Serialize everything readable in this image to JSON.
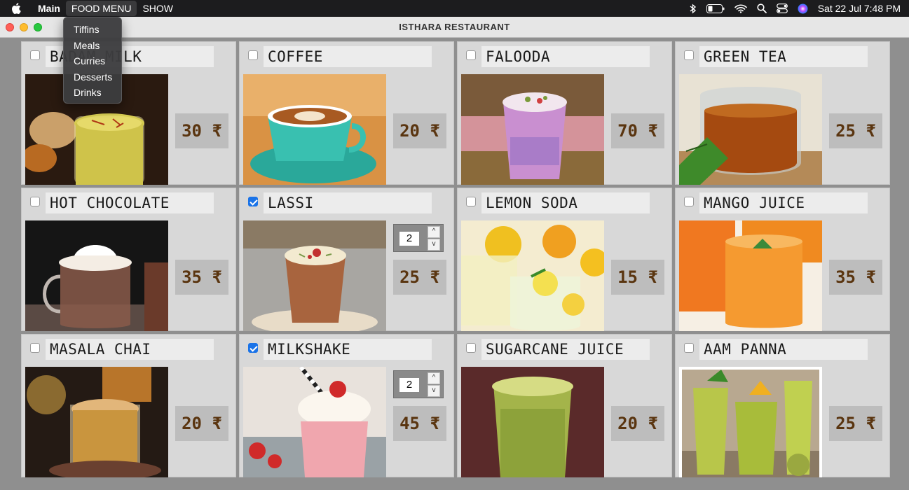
{
  "menubar": {
    "app_name": "Main",
    "menus": [
      "FOOD MENU",
      "SHOW"
    ],
    "active_menu": "FOOD MENU",
    "clock": "Sat 22 Jul  7:48 PM"
  },
  "window": {
    "title": "ISTHARA RESTAURANT"
  },
  "food_menu_dropdown": [
    "Tiffins",
    "Meals",
    "Curries",
    "Desserts",
    "Drinks"
  ],
  "items": [
    {
      "name": "BADAM MILK",
      "price": "30 ₹",
      "checked": false,
      "photo": "badam-milk"
    },
    {
      "name": "COFFEE",
      "price": "20 ₹",
      "checked": false,
      "photo": "coffee"
    },
    {
      "name": "FALOODA",
      "price": "70 ₹",
      "checked": false,
      "photo": "falooda"
    },
    {
      "name": "GREEN TEA",
      "price": "25 ₹",
      "checked": false,
      "photo": "green-tea"
    },
    {
      "name": "HOT CHOCOLATE",
      "price": "35 ₹",
      "checked": false,
      "photo": "hot-chocolate"
    },
    {
      "name": "LASSI",
      "price": "25 ₹",
      "checked": true,
      "quantity": "2",
      "photo": "lassi"
    },
    {
      "name": "LEMON SODA",
      "price": "15 ₹",
      "checked": false,
      "photo": "lemon-soda"
    },
    {
      "name": "MANGO JUICE",
      "price": "35 ₹",
      "checked": false,
      "photo": "mango-juice"
    },
    {
      "name": "MASALA CHAI",
      "price": "20 ₹",
      "checked": false,
      "photo": "masala-chai"
    },
    {
      "name": "MILKSHAKE",
      "price": "45 ₹",
      "checked": true,
      "quantity": "2",
      "photo": "milkshake"
    },
    {
      "name": "SUGARCANE JUICE",
      "price": "20 ₹",
      "checked": false,
      "photo": "sugarcane-juice"
    },
    {
      "name": "AAM PANNA",
      "price": "25 ₹",
      "checked": false,
      "photo": "aam-panna"
    }
  ],
  "stepper": {
    "up": "^",
    "down": "v"
  }
}
